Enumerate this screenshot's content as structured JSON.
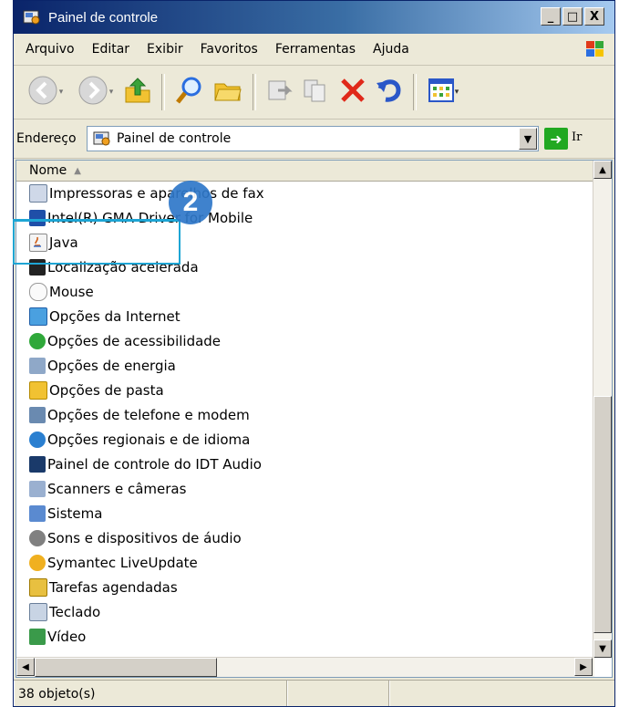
{
  "window": {
    "title": "Painel de controle",
    "controls": {
      "minimize": "_",
      "maximize": "□",
      "close": "X"
    }
  },
  "menu": {
    "items": [
      "Arquivo",
      "Editar",
      "Exibir",
      "Favoritos",
      "Ferramentas",
      "Ajuda"
    ]
  },
  "address": {
    "label": "Endereço",
    "value": "Painel de controle",
    "go_label": "Ir"
  },
  "list": {
    "column_header": "Nome",
    "items": [
      {
        "label": "Impressoras e aparelhos de fax",
        "icon": "printer-icon"
      },
      {
        "label": "Intel(R) GMA Driver for Mobile",
        "icon": "display-driver-icon"
      },
      {
        "label": "Java",
        "icon": "java-icon"
      },
      {
        "label": "Localização acelerada",
        "icon": "binoculars-icon"
      },
      {
        "label": "Mouse",
        "icon": "mouse-icon"
      },
      {
        "label": "Opções da Internet",
        "icon": "internet-options-icon"
      },
      {
        "label": "Opções de acessibilidade",
        "icon": "accessibility-icon"
      },
      {
        "label": "Opções de energia",
        "icon": "power-icon"
      },
      {
        "label": "Opções de pasta",
        "icon": "folder-options-icon"
      },
      {
        "label": "Opções de telefone e modem",
        "icon": "phone-modem-icon"
      },
      {
        "label": "Opções regionais e de idioma",
        "icon": "globe-icon"
      },
      {
        "label": "Painel de controle do IDT Audio",
        "icon": "audio-icon"
      },
      {
        "label": "Scanners e câmeras",
        "icon": "scanner-icon"
      },
      {
        "label": "Sistema",
        "icon": "system-icon"
      },
      {
        "label": "Sons e dispositivos de áudio",
        "icon": "speaker-icon"
      },
      {
        "label": "Symantec LiveUpdate",
        "icon": "liveupdate-icon"
      },
      {
        "label": "Tarefas agendadas",
        "icon": "scheduled-tasks-icon"
      },
      {
        "label": "Teclado",
        "icon": "keyboard-icon"
      },
      {
        "label": "Vídeo",
        "icon": "video-icon"
      }
    ]
  },
  "status": {
    "count_text": "38 objeto(s)"
  },
  "annotation": {
    "step_number": "2",
    "highlight_color": "#1ea5d4",
    "badge_color": "#2f78c9"
  },
  "colors": {
    "titlebar": "#0a246a",
    "window_bg": "#ece9d8"
  }
}
